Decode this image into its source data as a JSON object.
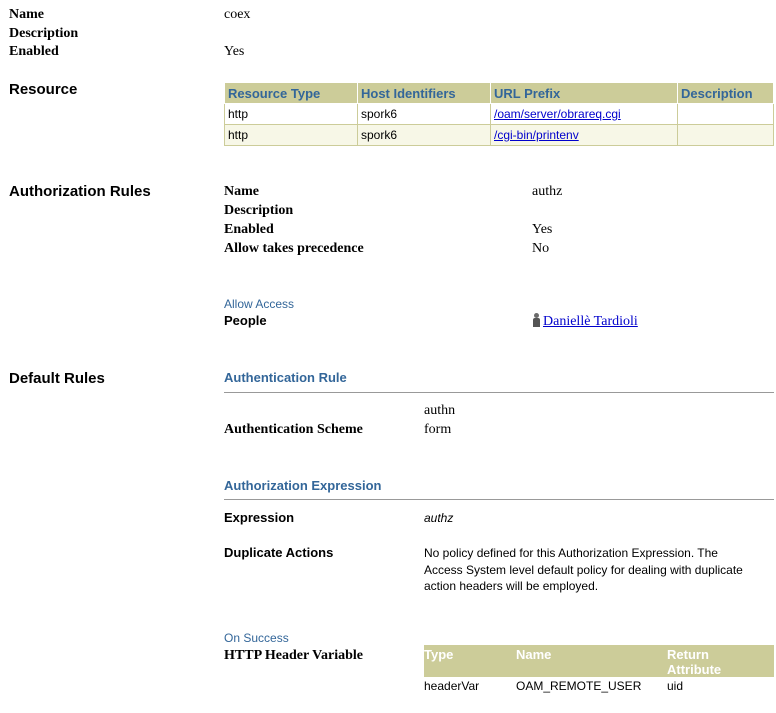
{
  "summary": {
    "name_label": "Name",
    "name_value": "coex",
    "description_label": "Description",
    "enabled_label": "Enabled",
    "enabled_value": "Yes"
  },
  "resource": {
    "section_title": "Resource",
    "columns": [
      "Resource Type",
      "Host Identifiers",
      "URL Prefix",
      "Description"
    ],
    "rows": [
      {
        "type": "http",
        "host": "spork6",
        "url": "/oam/server/obrareq.cgi",
        "description": ""
      },
      {
        "type": "http",
        "host": "spork6",
        "url": "/cgi-bin/printenv",
        "description": ""
      }
    ]
  },
  "authorization_rules": {
    "section_title": "Authorization Rules",
    "name_label": "Name",
    "name_value": "authz",
    "description_label": "Description",
    "enabled_label": "Enabled",
    "enabled_value": "Yes",
    "allow_label": "Allow takes precedence",
    "allow_value": "No",
    "allow_access_label": "Allow Access",
    "people_label": "People",
    "people_value": "Daniellè Tardioli"
  },
  "default_rules": {
    "section_title": "Default Rules",
    "authn_heading": "Authentication Rule",
    "authn_name": "authn",
    "authn_scheme_label": "Authentication Scheme",
    "authn_scheme_value": "form",
    "authz_heading": "Authorization Expression",
    "expression_label": "Expression",
    "expression_value": "authz",
    "dup_label": "Duplicate Actions",
    "dup_line1": "No policy defined for this Authorization Expression. The",
    "dup_line2": "Access System level default policy for dealing with duplicate",
    "dup_line3": "action headers will be employed.",
    "on_success_label": "On Success",
    "http_header_label": "HTTP Header Variable",
    "header_columns": {
      "type": "Type",
      "name": "Name",
      "return1": "Return",
      "return2": "Attribute"
    },
    "header_row": {
      "type": "headerVar",
      "name": "OAM_REMOTE_USER",
      "return": "uid"
    }
  },
  "colors": {
    "header_bar": "#cccc99",
    "accent": "#336699",
    "link": "#0000cc"
  }
}
